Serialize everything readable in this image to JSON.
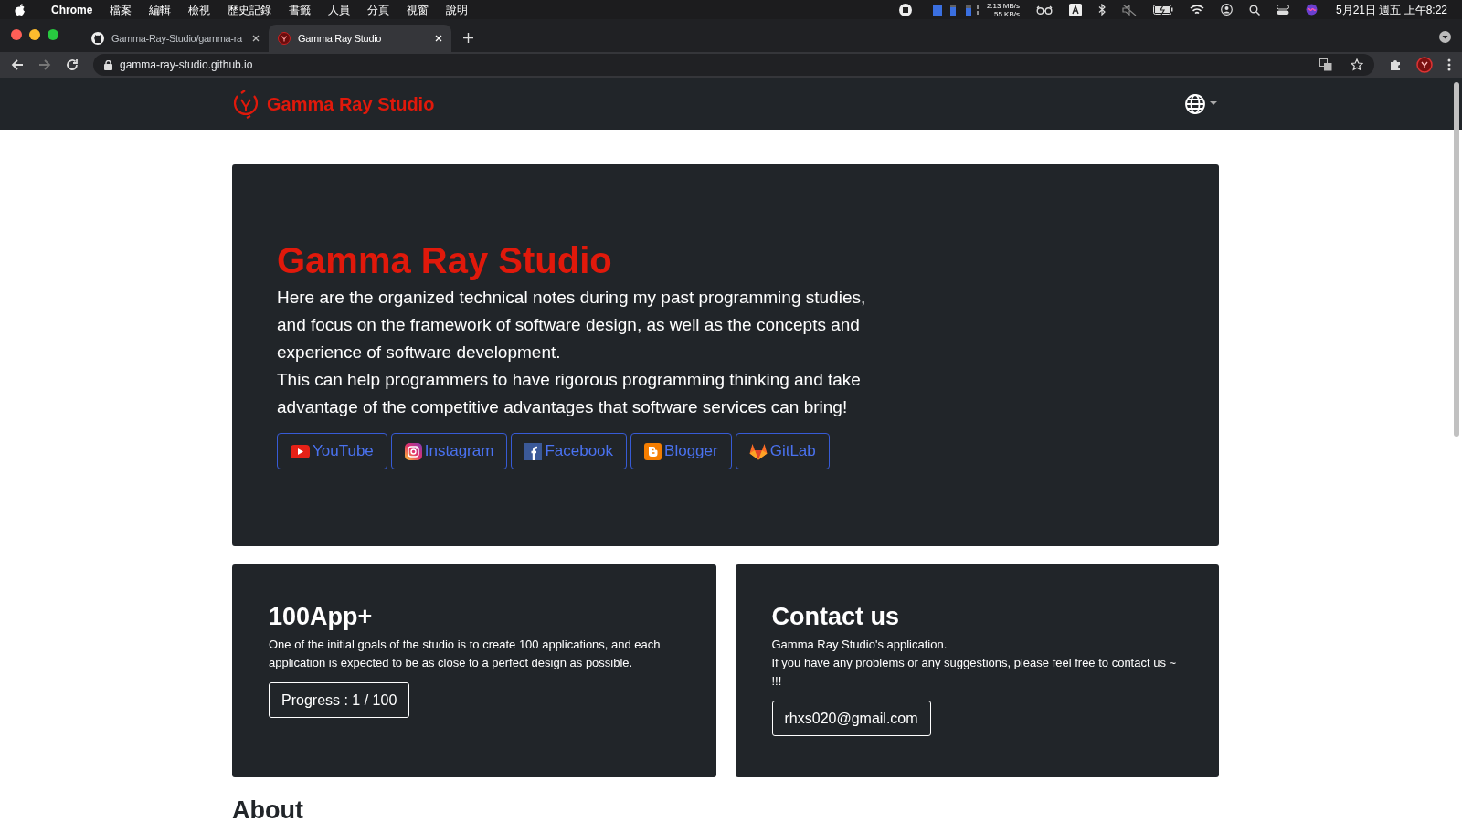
{
  "menu_bar": {
    "app": "Chrome",
    "items": [
      "檔案",
      "編輯",
      "檢視",
      "歷史記錄",
      "書籤",
      "人員",
      "分頁",
      "視窗",
      "說明"
    ],
    "net_up": "2.13 MB/s",
    "net_down": "55 KB/s",
    "clock": "5月21日 週五 上午8:22"
  },
  "tabs": [
    {
      "title": "Gamma-Ray-Studio/gamma-ra",
      "kind": "github",
      "selected": false
    },
    {
      "title": "Gamma Ray Studio",
      "kind": "site",
      "selected": true
    }
  ],
  "address_bar": {
    "url": "gamma-ray-studio.github.io"
  },
  "navbar": {
    "brand": "Gamma Ray Studio"
  },
  "hero": {
    "title": "Gamma Ray Studio",
    "paragraphs": [
      "Here are the organized technical notes during my past programming studies, and focus on the framework of software design, as well as the concepts and experience of software development.",
      "This can help programmers to have rigorous programming thinking and take advantage of the competitive advantages that software services can bring!"
    ],
    "buttons": [
      {
        "label": "YouTube",
        "kind": "youtube"
      },
      {
        "label": "Instagram",
        "kind": "instagram"
      },
      {
        "label": "Facebook",
        "kind": "facebook"
      },
      {
        "label": "Blogger",
        "kind": "blogger"
      },
      {
        "label": "GitLab",
        "kind": "gitlab"
      }
    ]
  },
  "cards": [
    {
      "title": "100App+",
      "lines": [
        "One of the initial goals of the studio is to create 100 applications, and each application is expected to be as close to a perfect design as possible."
      ],
      "button": "Progress : 1 / 100"
    },
    {
      "title": "Contact us",
      "lines": [
        "Gamma Ray Studio's application.",
        "If you have any problems or any suggestions, please feel free to contact us ~ !!!"
      ],
      "button": "rhxs020@gmail.com"
    }
  ],
  "about": {
    "heading": "About"
  }
}
